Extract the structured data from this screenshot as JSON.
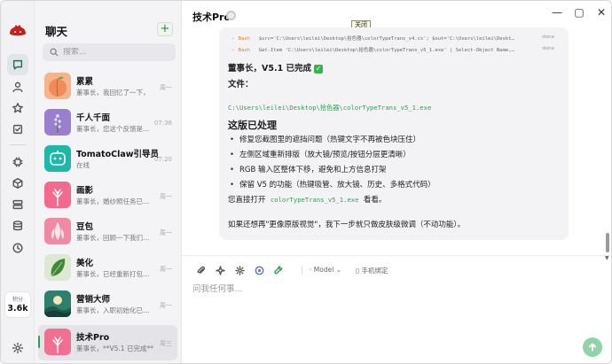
{
  "rail": {
    "points_label": "积分",
    "points_value": "3.6k"
  },
  "chat_list": {
    "title": "聊天",
    "search_placeholder": "搜索...",
    "items": [
      {
        "name": "累累",
        "preview": "董事长，我回忆了一下，",
        "time": "周一"
      },
      {
        "name": "千人千面",
        "preview": "董事长，您这个反馈是…",
        "time": "07:36"
      },
      {
        "name": "TomatoClaw引导员",
        "preview": "在线",
        "time": "07:20"
      },
      {
        "name": "画影",
        "preview": "董事长，婚纱照任务已创…",
        "time": "周一"
      },
      {
        "name": "豆包",
        "preview": "董事长，回顾一下我们这…",
        "time": "周一"
      },
      {
        "name": "美化",
        "preview": "董事长，已经重新打包完…",
        "time": "周一"
      },
      {
        "name": "营销大师",
        "preview": "董事长，入职初始化已完…",
        "time": "周一"
      },
      {
        "name": "技术Pro",
        "preview": "董事长，**V5.1 已完成**",
        "time": "周三"
      }
    ]
  },
  "window": {
    "title": "技术Pro",
    "tooltip": "关闭",
    "minimize": "—",
    "maximize": "▢",
    "close": "✕"
  },
  "message": {
    "tools": [
      {
        "name": "Bash",
        "cmd": "$src='C:\\Users\\leilei\\Desktop\\拾色器\\colorTypeTrans_v4.cs'; $out='C:\\Users\\leilei\\Deskt…",
        "status": "done"
      },
      {
        "name": "Bash",
        "cmd": "Get-Item 'C:\\Users\\leilei\\Desktop\\拾色器\\colorTypeTrans_v5_1.exe' | Select-Object Name,…",
        "status": "done"
      }
    ],
    "done_line": "董事长，V5.1 已完成",
    "file_label": "文件：",
    "file_path": "C:\\Users\\leilei\\Desktop\\拾色器\\colorTypeTrans_v5_1.exe",
    "heading": "这版已处理",
    "bullets": [
      "修复您截图里的遮挡问题（热键文字不再被色块压住）",
      "左侧区域重新排版（放大镜/预览/按钮分层更清晰）",
      "RGB 输入区整体下移，避免和上方信息打架",
      "保留 V5 的功能（热键吸管、放大镜、历史、多格式代码）"
    ],
    "open_prefix": "您直接打开",
    "open_file": "colorTypeTrans_v5_1.exe",
    "open_suffix": "看看。",
    "footer": "如果还想再\"更像原版视觉\"，我下一步就只做皮肤级微调（不动功能）。"
  },
  "composer": {
    "model_label": "Model",
    "phone_label": "手机绑定",
    "placeholder": "问我任何事..."
  },
  "colors": {
    "accent": "#2f9e57",
    "send_button": "#8fd3a6",
    "tool_name": "#e0801a"
  }
}
